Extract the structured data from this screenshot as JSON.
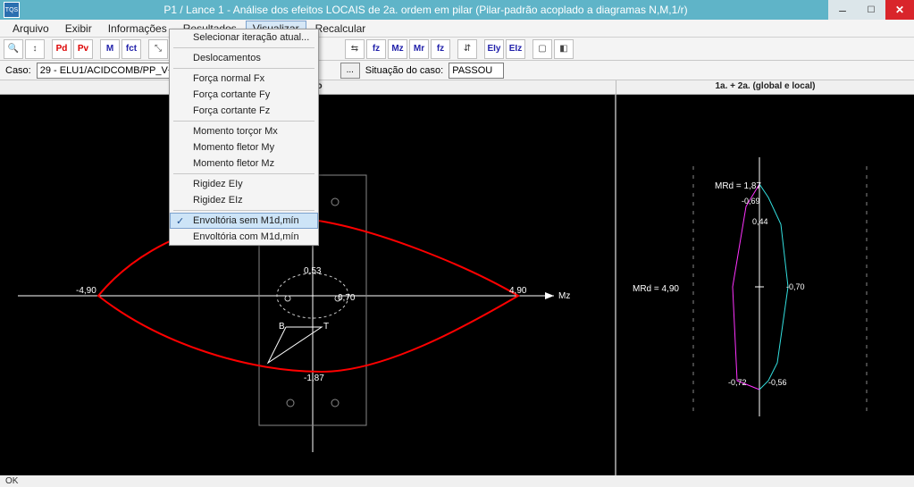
{
  "titlebar": {
    "app_icon_text": "TQS",
    "title": "P1 / Lance 1 - Análise dos efeitos LOCAIS de 2a. ordem em pilar (Pilar-padrão acoplado a diagramas N,M,1/r)"
  },
  "menubar": {
    "items": [
      "Arquivo",
      "Exibir",
      "Informações",
      "Resultados",
      "Visualizar",
      "Recalcular"
    ],
    "active_index": 4
  },
  "toolbar": {
    "b1": "🔍",
    "b2": "↕",
    "b3": "Pd",
    "b4": "Pv",
    "b5": "M",
    "b6": "fct",
    "b7": "⤡",
    "b8": "↕",
    "b9": "⇆",
    "b10": "fz",
    "b11": "Mz",
    "b12": "Mr",
    "b13": "fz",
    "b14": "⇵",
    "b15": "EIy",
    "b16": "EIz",
    "b17": "▢",
    "b18": "◧"
  },
  "caserow": {
    "label": "Caso:",
    "case_value": "29 - ELU1/ACIDCOMB/PP_V+PERM_V+0.8",
    "nav_prev": "◄",
    "nav_next": "►",
    "dots": "...",
    "status_label": "Situação do caso:",
    "status_value": "PASSOU"
  },
  "panels": {
    "left_title": "eração",
    "right_title": "1a. + 2a. (global e local)"
  },
  "dropdown": {
    "items": [
      {
        "label": "Selecionar iteração atual...",
        "sep_after": true
      },
      {
        "label": "Deslocamentos",
        "sep_after": true
      },
      {
        "label": "Força normal Fx"
      },
      {
        "label": "Força cortante Fy"
      },
      {
        "label": "Força cortante Fz",
        "sep_after": true
      },
      {
        "label": "Momento torçor Mx"
      },
      {
        "label": "Momento fletor My"
      },
      {
        "label": "Momento fletor Mz",
        "sep_after": true
      },
      {
        "label": "Rigidez EIy"
      },
      {
        "label": "Rigidez EIz",
        "sep_after": true
      },
      {
        "label": "Envoltória sem M1d,mín",
        "checked": true,
        "selected": true
      },
      {
        "label": "Envoltória com M1d,mín"
      }
    ]
  },
  "vp_left": {
    "xneg": "-4,90",
    "xpos": "4,90",
    "axis": "Mz",
    "top_val": "0,53",
    "ctr_val": "0,70",
    "bot_val": "-1,87",
    "B": "B",
    "T": "T"
  },
  "vp_right": {
    "mrd1": "MRd = 1,87",
    "mrd2": "MRd = 4,90",
    "v1": "-0,69",
    "v2": "0,44",
    "v3": "-0,70",
    "v4": "-0,72",
    "v5": "-0,56"
  },
  "statusbar": {
    "text": "OK"
  }
}
